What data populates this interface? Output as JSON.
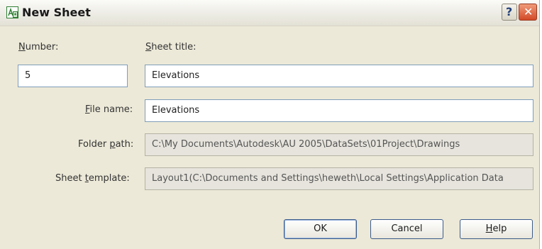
{
  "window": {
    "title": "New Sheet"
  },
  "titlebar": {
    "help_glyph": "?",
    "close_glyph": "✕"
  },
  "icons": {
    "app": "autocad-sheet-icon",
    "help": "help-icon",
    "close": "close-icon"
  },
  "colors": {
    "dialog_bg": "#ece9d8",
    "close_red": "#d24a28",
    "input_border": "#7f9db9"
  },
  "form": {
    "number": {
      "label_mnemonic": "N",
      "label_rest": "umber:",
      "value": "5"
    },
    "sheet_title": {
      "label_mnemonic": "S",
      "label_rest": "heet title:",
      "value": "Elevations"
    },
    "file_name": {
      "label_mnemonic": "F",
      "label_rest": "ile name:",
      "value": "Elevations"
    },
    "folder_path": {
      "label_pre": "Folder ",
      "label_mnemonic": "p",
      "label_post": "ath:",
      "value": "C:\\My Documents\\Autodesk\\AU 2005\\DataSets\\01Project\\Drawings"
    },
    "sheet_template": {
      "label_pre": "Sheet ",
      "label_mnemonic": "t",
      "label_post": "emplate:",
      "value": "Layout1(C:\\Documents and Settings\\heweth\\Local Settings\\Application Data"
    }
  },
  "buttons": {
    "ok": "OK",
    "cancel": "Cancel",
    "help_mnemonic": "H",
    "help_rest": "elp"
  }
}
